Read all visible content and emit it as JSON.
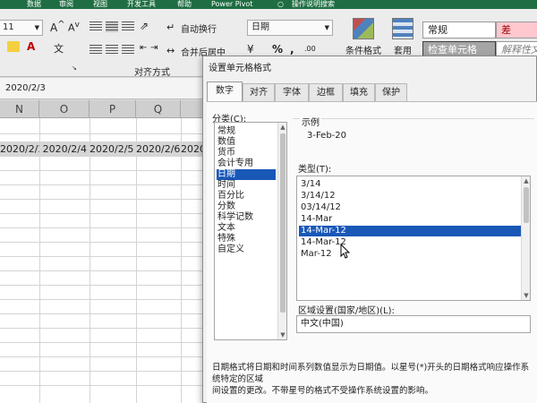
{
  "ribbon": {
    "top_tabs": [
      "数据",
      "审阅",
      "视图",
      "开发工具",
      "帮助",
      "Power Pivot",
      "操作说明搜索"
    ],
    "font_size": "11",
    "wrap_text": "自动换行",
    "merge_center": "合并后居中",
    "alignment_group": "对齐方式",
    "number_format": "日期",
    "percent": "%",
    "comma": ",",
    "conditional_format": "条件格式",
    "format_table": "套用",
    "style_normal": "常规",
    "style_bad": "差",
    "style_check": "检查单元格",
    "style_explain": "解释性文本"
  },
  "formula_bar": {
    "value": "2020/2/3"
  },
  "grid": {
    "columns": [
      "N",
      "O",
      "P",
      "Q"
    ],
    "row_cells": [
      "2020/2/3",
      "2020/2/4",
      "2020/2/5",
      "2020/2/6",
      "2020/2"
    ]
  },
  "dialog": {
    "title": "设置单元格格式",
    "tabs": [
      "数字",
      "对齐",
      "字体",
      "边框",
      "填充",
      "保护"
    ],
    "category_label": "分类(C):",
    "categories": [
      "常规",
      "数值",
      "货币",
      "会计专用",
      "日期",
      "时间",
      "百分比",
      "分数",
      "科学记数",
      "文本",
      "特殊",
      "自定义"
    ],
    "selected_category": "日期",
    "sample_label": "示例",
    "sample_value": "3-Feb-20",
    "type_label": "类型(T):",
    "types": [
      "3/14",
      "3/14/12",
      "03/14/12",
      "14-Mar",
      "14-Mar-12",
      "14-Mar-12",
      "Mar-12"
    ],
    "locale_label": "区域设置(国家/地区)(L):",
    "locale_value": "中文(中国)",
    "description_line1": "日期格式将日期和时间系列数值显示为日期值。以星号(*)开头的日期格式响应操作系统特定的区域",
    "description_line2": "间设置的更改。不带星号的格式不受操作系统设置的影响。"
  },
  "colors": {
    "selection": "#1a58b8",
    "ribbon_green": "#1f6e43",
    "bad_style_bg": "#ffc7ce",
    "bad_style_text": "#9c0006"
  }
}
